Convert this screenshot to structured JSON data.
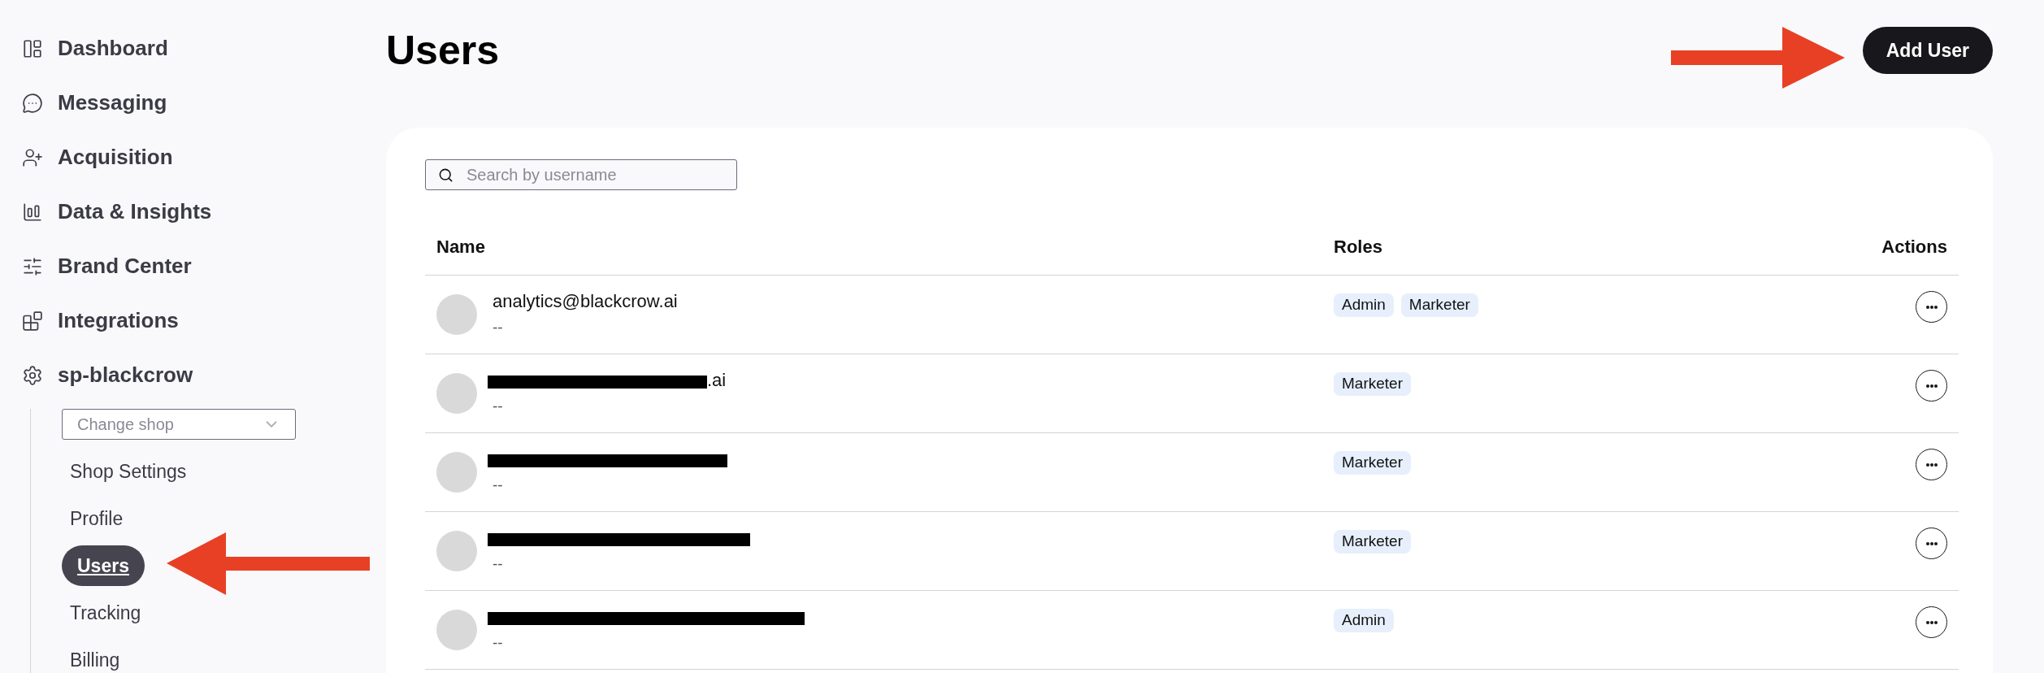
{
  "sidebar": {
    "items": [
      {
        "label": "Dashboard"
      },
      {
        "label": "Messaging"
      },
      {
        "label": "Acquisition"
      },
      {
        "label": "Data & Insights"
      },
      {
        "label": "Brand Center"
      },
      {
        "label": "Integrations"
      },
      {
        "label": "sp-blackcrow"
      }
    ],
    "shop_select": {
      "placeholder": "Change shop"
    },
    "sub_items": [
      {
        "label": "Shop Settings",
        "selected": false
      },
      {
        "label": "Profile",
        "selected": false
      },
      {
        "label": "Users",
        "selected": true
      },
      {
        "label": "Tracking",
        "selected": false
      },
      {
        "label": "Billing",
        "selected": false
      }
    ]
  },
  "page": {
    "title": "Users",
    "add_button": "Add User"
  },
  "search": {
    "placeholder": "Search by username"
  },
  "table": {
    "columns": [
      "Name",
      "Roles",
      "Actions"
    ],
    "rows": [
      {
        "email": "analytics@blackcrow.ai",
        "redacted": false,
        "subtitle": "--",
        "roles": [
          "Admin",
          "Marketer"
        ]
      },
      {
        "email": ".ai",
        "redacted": true,
        "subtitle": "--",
        "roles": [
          "Marketer"
        ]
      },
      {
        "redacted": true,
        "subtitle": "--",
        "roles": [
          "Marketer"
        ]
      },
      {
        "redacted": true,
        "subtitle": "--",
        "roles": [
          "Marketer"
        ]
      },
      {
        "redacted": true,
        "subtitle": "--",
        "roles": [
          "Admin"
        ]
      }
    ]
  }
}
